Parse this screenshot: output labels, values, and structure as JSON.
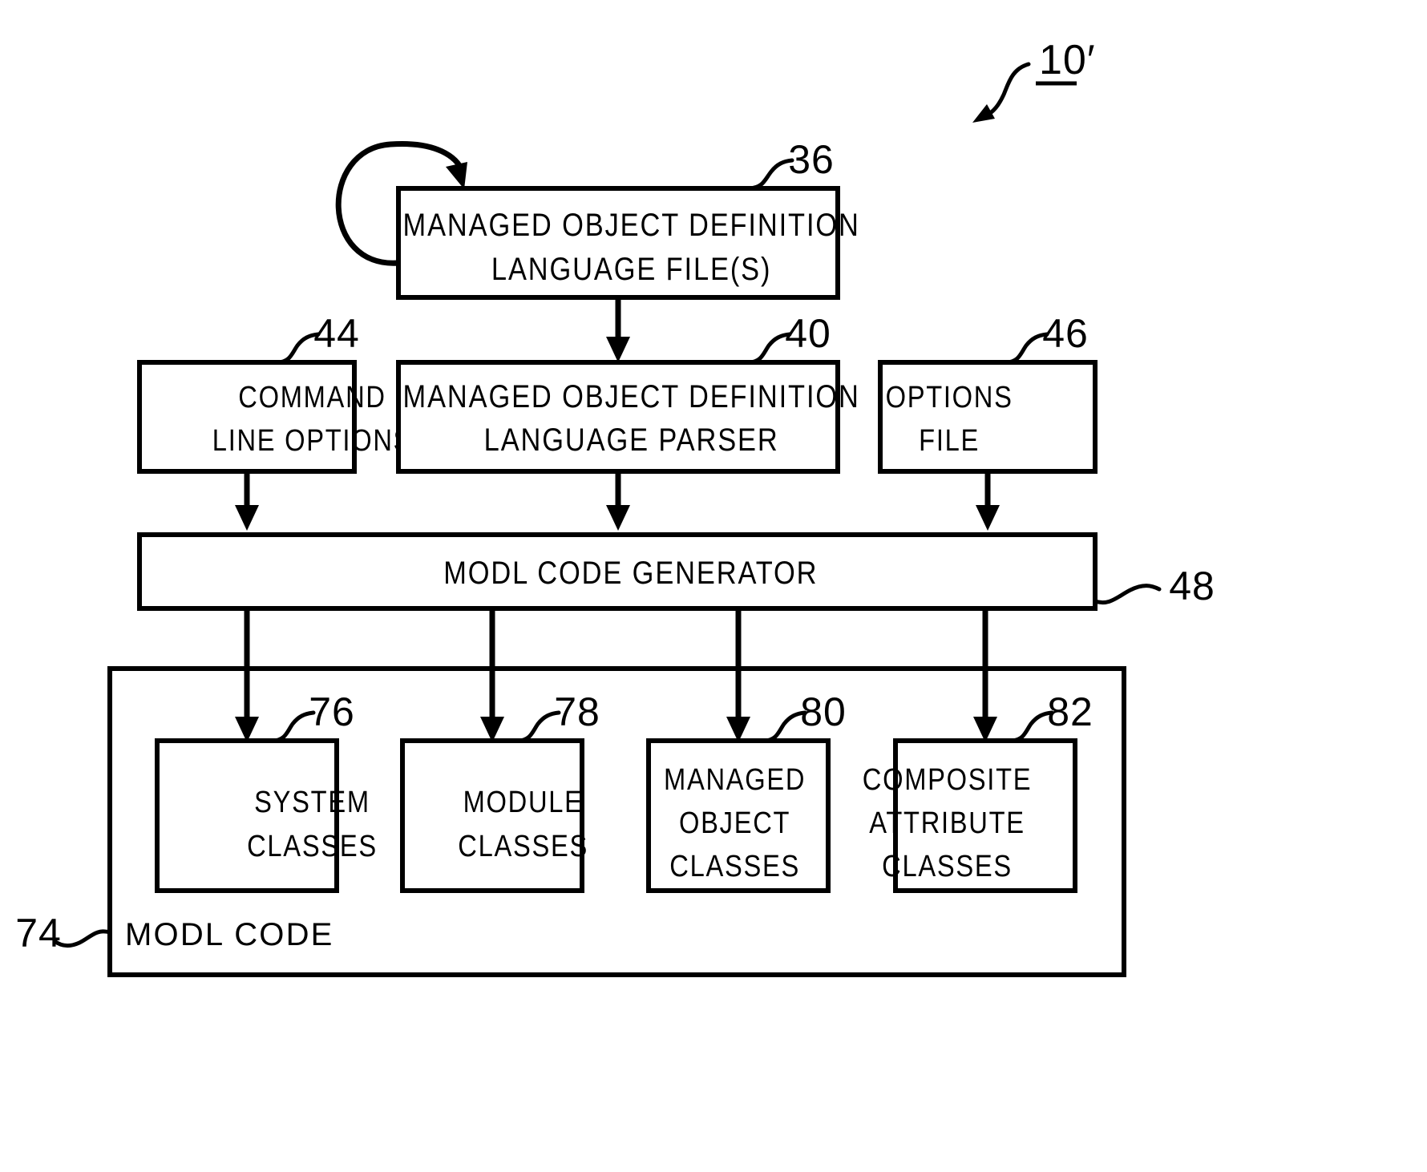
{
  "figure": {
    "label": "10′",
    "underlined": true
  },
  "boxes": {
    "modl_files": {
      "ref": "36",
      "lines": [
        "MANAGED OBJECT DEFINITION",
        "LANGUAGE FILE(S)"
      ]
    },
    "command_line_options": {
      "ref": "44",
      "lines": [
        "COMMAND",
        "LINE OPTIONS"
      ]
    },
    "modl_parser": {
      "ref": "40",
      "lines": [
        "MANAGED OBJECT DEFINITION",
        "LANGUAGE PARSER"
      ]
    },
    "options_file": {
      "ref": "46",
      "lines": [
        "OPTIONS",
        "FILE"
      ]
    },
    "code_generator": {
      "ref": "48",
      "lines": [
        "MODL CODE GENERATOR"
      ]
    },
    "modl_code_container": {
      "ref": "74",
      "lines": [
        "MODL CODE"
      ]
    },
    "system_classes": {
      "ref": "76",
      "lines": [
        "SYSTEM",
        "CLASSES"
      ]
    },
    "module_classes": {
      "ref": "78",
      "lines": [
        "MODULE",
        "CLASSES"
      ]
    },
    "managed_object_classes": {
      "ref": "80",
      "lines": [
        "MANAGED",
        "OBJECT",
        "CLASSES"
      ]
    },
    "composite_attribute_classes": {
      "ref": "82",
      "lines": [
        "COMPOSITE",
        "ATTRIBUTE",
        "CLASSES"
      ]
    }
  },
  "colors": {
    "ink": "#000000",
    "paper": "#ffffff"
  }
}
